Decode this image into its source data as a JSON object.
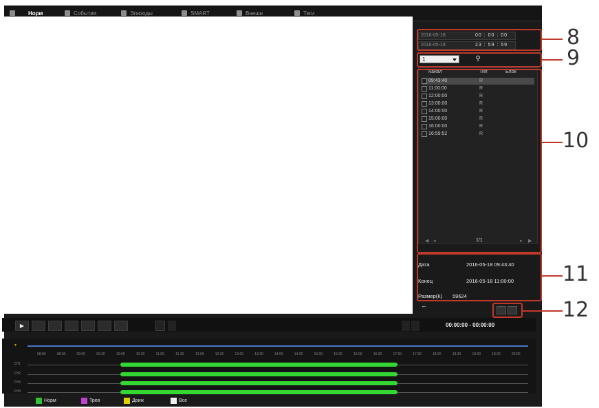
{
  "menu": {
    "items": [
      {
        "label": "Норм",
        "active": true
      },
      {
        "label": "События"
      },
      {
        "label": "Эпизоды"
      },
      {
        "label": "SMART"
      },
      {
        "label": "Внешн"
      },
      {
        "label": "Теги"
      }
    ]
  },
  "search": {
    "start": {
      "date": "2016-05-18",
      "time": "00 : 00 : 00"
    },
    "end": {
      "date": "2016-05-18",
      "time": "23 : 59 : 59"
    },
    "filter_value": "1",
    "search_icon": "search-icon"
  },
  "file_list": {
    "headers": {
      "channel": "Канал",
      "type": "Тип",
      "lock": "Блок"
    },
    "rows": [
      {
        "time": "09:43:40",
        "type": "R",
        "selected": true
      },
      {
        "time": "11:00:00",
        "type": "R"
      },
      {
        "time": "12:00:00",
        "type": "R"
      },
      {
        "time": "13:00:00",
        "type": "R"
      },
      {
        "time": "14:00:00",
        "type": "R"
      },
      {
        "time": "15:00:00",
        "type": "R"
      },
      {
        "time": "16:00:00",
        "type": "R"
      },
      {
        "time": "16:59:52",
        "type": "R"
      }
    ],
    "page": "1/1"
  },
  "file_info": {
    "start_label": "Дата",
    "start_value": "2016-05-18 09:43:40",
    "end_label": "Конец",
    "end_value": "2016-05-18 11:00:00",
    "size_label": "Размер(К)",
    "size_value": "59624"
  },
  "playback": {
    "time_display": "00:00:00  -  00:00:00"
  },
  "timeline": {
    "tick_labels": [
      "08:00",
      "08:30",
      "09:00",
      "09:30",
      "10:00",
      "10:30",
      "11:00",
      "11:30",
      "12:00",
      "12:30",
      "13:00",
      "13:30",
      "14:00",
      "14:30",
      "15:00",
      "15:30",
      "16:00",
      "16:30",
      "17:00",
      "17:30",
      "18:00",
      "18:30",
      "19:00",
      "19:30",
      "20:00"
    ],
    "channels": [
      "CH1",
      "CH2",
      "CH3",
      "CH4"
    ],
    "recorded_range": {
      "start": "10:00",
      "end": "17:00"
    }
  },
  "legend": [
    {
      "label": "Норм",
      "color": "#33c433"
    },
    {
      "label": "Трев",
      "color": "#c040d0"
    },
    {
      "label": "Движ",
      "color": "#e0d000"
    },
    {
      "label": "Все",
      "color": "#f0f0f0"
    }
  ],
  "callouts": [
    "8",
    "9",
    "10",
    "11",
    "12"
  ],
  "colors": {
    "callout": "#c0392b",
    "recorded": "#33d633",
    "scale": "#4a78c8"
  }
}
